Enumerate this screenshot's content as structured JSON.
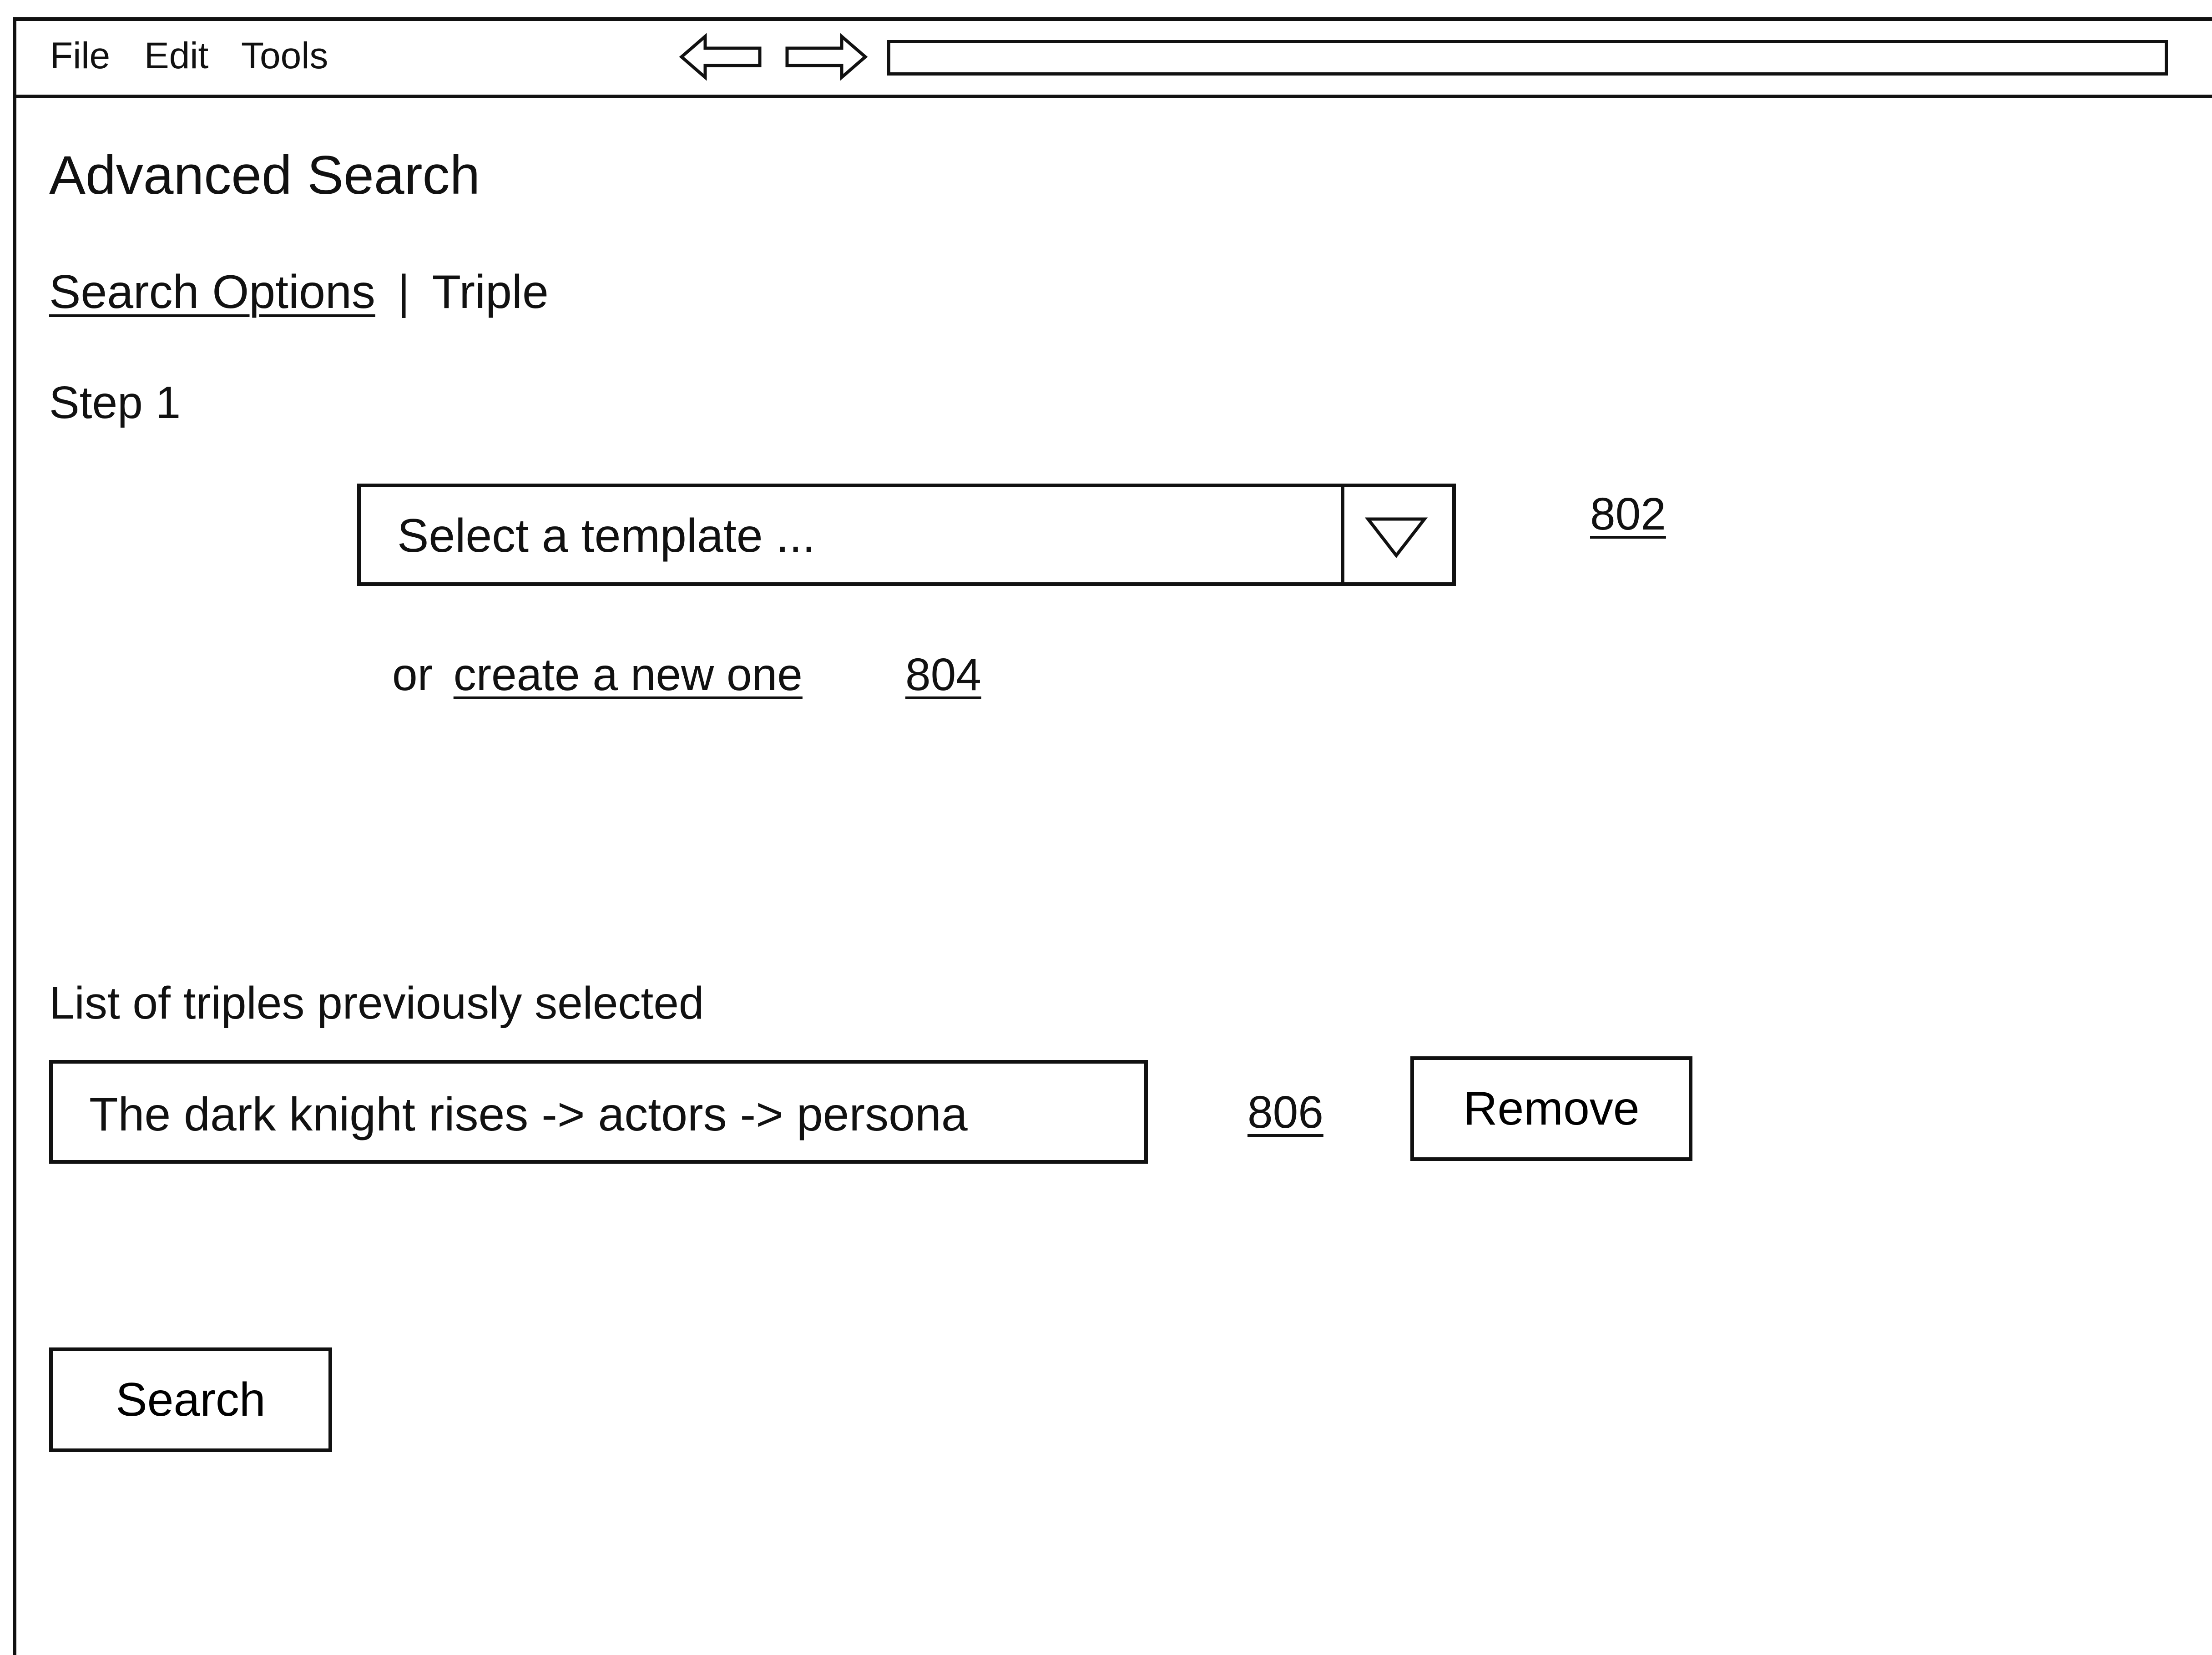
{
  "menu": {
    "file": "File",
    "edit": "Edit",
    "tools": "Tools"
  },
  "nav": {
    "back_icon": "left-arrow-icon",
    "forward_icon": "right-arrow-icon",
    "address_value": ""
  },
  "page": {
    "title": "Advanced Search"
  },
  "breadcrumb": {
    "link": "Search Options",
    "separator": "|",
    "current": "Triple"
  },
  "step": {
    "label": "Step 1"
  },
  "template_select": {
    "placeholder": "Select a template ...",
    "arrow_icon": "triangle-down-icon",
    "ref": "802"
  },
  "create": {
    "prefix": "or",
    "link": "create a new one",
    "ref": "804"
  },
  "triples": {
    "label": "List of triples previously selected",
    "items": [
      "The dark knight rises -> actors -> persona"
    ],
    "ref": "806",
    "remove_label": "Remove"
  },
  "search_button": {
    "label": "Search"
  }
}
